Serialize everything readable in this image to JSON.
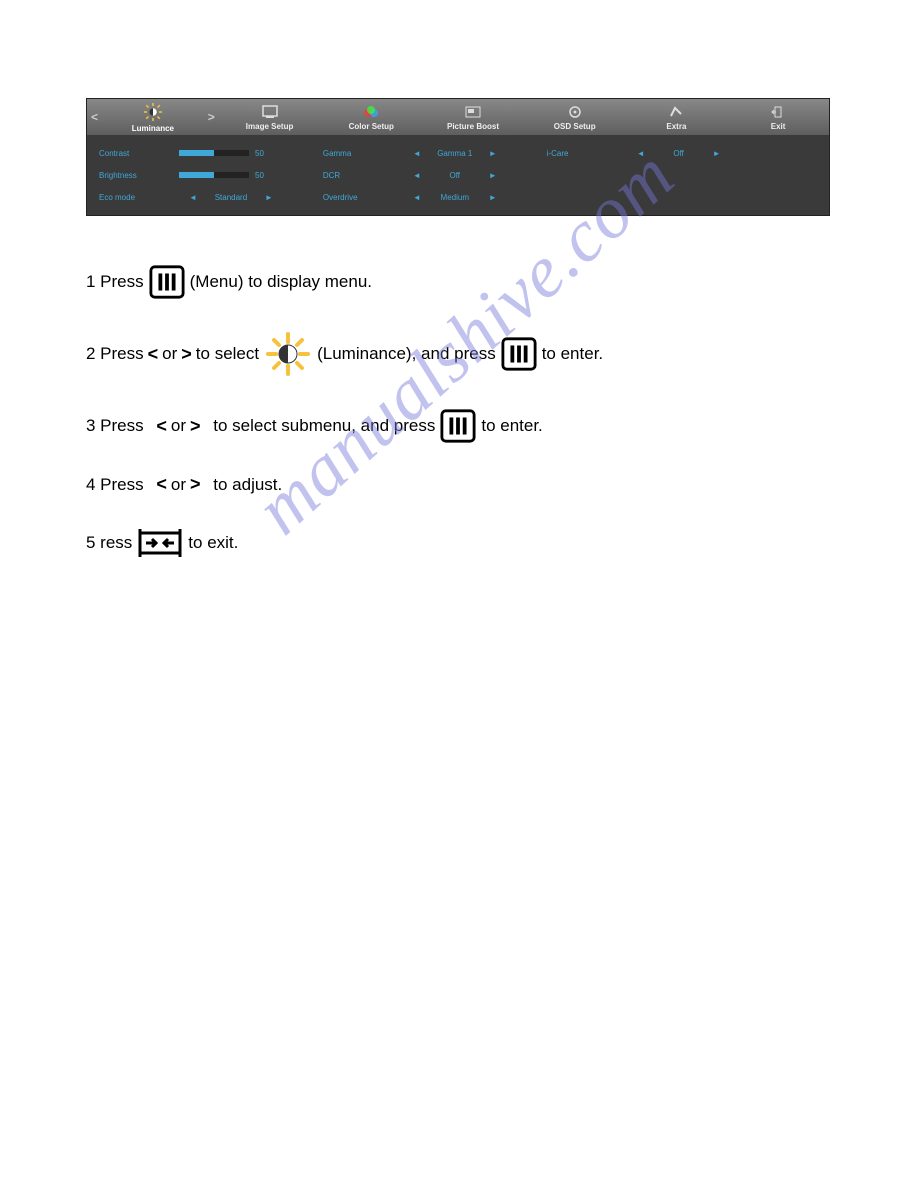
{
  "watermark": "manualshive.com",
  "osd": {
    "tabs": {
      "luminance": "Luminance",
      "image": "Image Setup",
      "color": "Color Setup",
      "picture": "Picture Boost",
      "osdset": "OSD Setup",
      "extra": "Extra",
      "exit": "Exit"
    },
    "left_col": {
      "contrast": {
        "label": "Contrast",
        "value": "50"
      },
      "brightness": {
        "label": "Brightness",
        "value": "50"
      },
      "eco": {
        "label": "Eco mode",
        "value": "Standard"
      }
    },
    "mid_col": {
      "gamma": {
        "label": "Gamma",
        "value": "Gamma 1"
      },
      "dcr": {
        "label": "DCR",
        "value": "Off"
      },
      "overdrive": {
        "label": "Overdrive",
        "value": "Medium"
      }
    },
    "right_col": {
      "icare": {
        "label": "i-Care",
        "value": "Off"
      }
    }
  },
  "instr": {
    "s1a": "1 Press",
    "s1b": "(Menu) to display menu.",
    "s2a": "2 Press",
    "lt": "<",
    "or": "or",
    "gt": ">",
    "s2b": "to select",
    "s2c": "(Luminance), and press",
    "s2d": "to enter.",
    "s3a": "3 Press",
    "s3b": "to select submenu, and press",
    "s3c": "to enter.",
    "s4a": "4   Press",
    "s4b": "to adjust.",
    "s5a": "5 ress",
    "s5b": "to exit."
  }
}
